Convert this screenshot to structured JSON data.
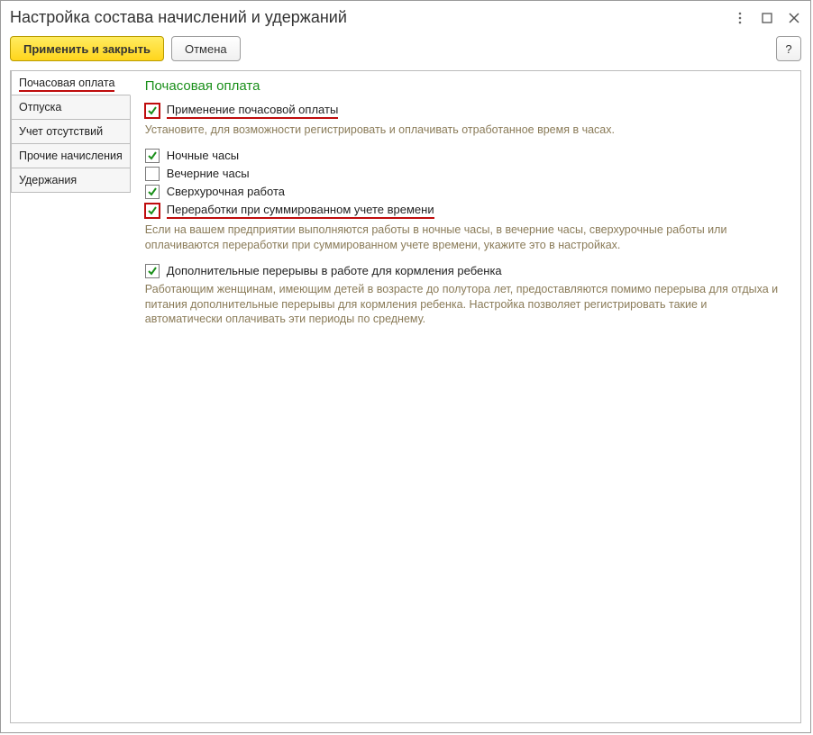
{
  "window": {
    "title": "Настройка состава начислений и удержаний"
  },
  "toolbar": {
    "apply_close": "Применить и закрыть",
    "cancel": "Отмена",
    "help": "?"
  },
  "sidebar": {
    "items": [
      {
        "label": "Почасовая оплата",
        "active": true,
        "underline": true
      },
      {
        "label": "Отпуска"
      },
      {
        "label": "Учет отсутствий"
      },
      {
        "label": "Прочие начисления"
      },
      {
        "label": "Удержания"
      }
    ]
  },
  "main": {
    "title": "Почасовая оплата",
    "use_hourly": {
      "label": "Применение почасовой оплаты",
      "checked": true
    },
    "use_hourly_desc": "Установите, для возможности регистрировать и оплачивать отработанное время в часах.",
    "night": {
      "label": "Ночные часы",
      "checked": true
    },
    "evening": {
      "label": "Вечерние часы",
      "checked": false
    },
    "overtime": {
      "label": "Сверхурочная работа",
      "checked": true
    },
    "summed": {
      "label": "Переработки при суммированном учете времени",
      "checked": true
    },
    "hours_desc": "Если на вашем предприятии выполняются работы в ночные часы, в вечерние часы, сверхурочные работы или оплачиваются переработки при суммированном учете времени, укажите это в настройках.",
    "nursing": {
      "label": "Дополнительные перерывы в работе для кормления ребенка",
      "checked": true
    },
    "nursing_desc": "Работающим женщинам, имеющим детей в возрасте до полутора лет, предоставляются помимо перерыва для отдыха и питания дополнительные перерывы для кормления ребенка. Настройка позволяет регистрировать такие и автоматически оплачивать эти периоды по среднему."
  }
}
